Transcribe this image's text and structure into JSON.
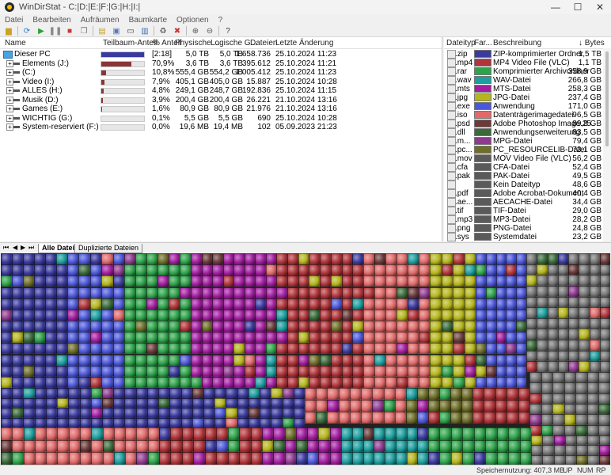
{
  "window": {
    "title": "WinDirStat - C:|D:|E:|F:|G:|H:|I:|"
  },
  "menu": [
    "Datei",
    "Bearbeiten",
    "Aufräumen",
    "Baumkarte",
    "Optionen",
    "?"
  ],
  "toolbar_icons": [
    "folder-open-icon",
    "refresh-icon",
    "play-icon",
    "pause-icon",
    "stop-icon",
    "copy-icon",
    "clipboard-icon",
    "explorer-icon",
    "cmd-icon",
    "properties-icon",
    "properties-icon",
    "recycle-icon",
    "delete-icon",
    "zoom-in-icon",
    "zoom-out-icon",
    "help-icon"
  ],
  "tree": {
    "headers": {
      "name": "Name",
      "subtree": "Teilbaum-Anteil",
      "percent": "% Anteil",
      "physical": "Physische ...",
      "logical": "Logische G...",
      "files": "Dateien",
      "modified": "Letzte Änderung"
    },
    "rows": [
      {
        "name": "Dieser PC",
        "bar_label": "[2:18]",
        "percent": "",
        "physical": "5,0 TB",
        "logical": "5,0 TB",
        "files": "1.658.736",
        "modified": "25.10.2024 11:23",
        "fill": 1.0
      },
      {
        "name": "Elements (J:)",
        "bar_label": "",
        "percent": "70,9%",
        "physical": "3,6 TB",
        "logical": "3,6 TB",
        "files": "395.612",
        "modified": "25.10.2024 11:21",
        "fill": 0.709
      },
      {
        "name": "(C:)",
        "bar_label": "",
        "percent": "10,8%",
        "physical": "555,4 GB",
        "logical": "554,2 GB",
        "files": "1.005.412",
        "modified": "25.10.2024 11:23",
        "fill": 0.108
      },
      {
        "name": "Video (I:)",
        "bar_label": "",
        "percent": "7,9%",
        "physical": "405,1 GB",
        "logical": "405,0 GB",
        "files": "15.887",
        "modified": "25.10.2024 10:28",
        "fill": 0.079
      },
      {
        "name": "ALLES (H:)",
        "bar_label": "",
        "percent": "4,8%",
        "physical": "249,1 GB",
        "logical": "248,7 GB",
        "files": "192.836",
        "modified": "25.10.2024 11:15",
        "fill": 0.048
      },
      {
        "name": "Musik (D:)",
        "bar_label": "",
        "percent": "3,9%",
        "physical": "200,4 GB",
        "logical": "200,4 GB",
        "files": "26.221",
        "modified": "21.10.2024 13:16",
        "fill": 0.039
      },
      {
        "name": "Games (E:)",
        "bar_label": "",
        "percent": "1,6%",
        "physical": "80,9 GB",
        "logical": "80,9 GB",
        "files": "21.976",
        "modified": "21.10.2024 13:16",
        "fill": 0.016
      },
      {
        "name": "WICHTIG (G:)",
        "bar_label": "",
        "percent": "0,1%",
        "physical": "5,5 GB",
        "logical": "5,5 GB",
        "files": "690",
        "modified": "25.10.2024 10:28",
        "fill": 0.001
      },
      {
        "name": "System-reserviert (F:)",
        "bar_label": "",
        "percent": "0,0%",
        "physical": "19,6 MB",
        "logical": "19,4 MB",
        "files": "102",
        "modified": "05.09.2023 21:23",
        "fill": 0.0
      }
    ]
  },
  "extensions": {
    "headers": {
      "type": "Dateityp",
      "color": "Far...",
      "description": "Beschreibung",
      "bytes": "↓ Bytes"
    },
    "rows": [
      {
        "ext": ".zip",
        "color": "#3b3b9e",
        "desc": "ZIP-komprimierter Ordner",
        "bytes": "1,5 TB"
      },
      {
        "ext": ".mp4",
        "color": "#b0353a",
        "desc": "MP4 Video File (VLC)",
        "bytes": "1,1 TB"
      },
      {
        "ext": ".rar",
        "color": "#2fa34b",
        "desc": "Komprimierter Archivordner",
        "bytes": "358,9 GB"
      },
      {
        "ext": ".wav",
        "color": "#1e9e9e",
        "desc": "WAV-Datei",
        "bytes": "266,8 GB"
      },
      {
        "ext": ".mts",
        "color": "#a21ea0",
        "desc": "MTS-Datei",
        "bytes": "258,3 GB"
      },
      {
        "ext": ".jpg",
        "color": "#b5b51e",
        "desc": "JPG-Datei",
        "bytes": "237,4 GB"
      },
      {
        "ext": ".exe",
        "color": "#4d58d8",
        "desc": "Anwendung",
        "bytes": "171,0 GB"
      },
      {
        "ext": ".iso",
        "color": "#e06a6a",
        "desc": "Datenträgerimagedatei",
        "bytes": "96,5 GB"
      },
      {
        "ext": ".psd",
        "color": "#6a3a3a",
        "desc": "Adobe Photoshop Image.25",
        "bytes": "89,8 GB"
      },
      {
        "ext": ".dll",
        "color": "#3a6a3a",
        "desc": "Anwendungserweiterung",
        "bytes": "83,5 GB"
      },
      {
        "ext": ".m...",
        "color": "#8e3a8e",
        "desc": "MPG-Datei",
        "bytes": "79,4 GB"
      },
      {
        "ext": ".pc...",
        "color": "#6e6e2a",
        "desc": "PC_RESOURCELIB-Datei",
        "bytes": "73,1 GB"
      },
      {
        "ext": ".mov",
        "color": "#5a5a5a",
        "desc": "MOV Video File (VLC)",
        "bytes": "56,2 GB"
      },
      {
        "ext": ".cfa",
        "color": "#5a5a5a",
        "desc": "CFA-Datei",
        "bytes": "52,4 GB"
      },
      {
        "ext": ".pak",
        "color": "#5a5a5a",
        "desc": "PAK-Datei",
        "bytes": "49,5 GB"
      },
      {
        "ext": "",
        "color": "#5a5a5a",
        "desc": "Kein Dateityp",
        "bytes": "48,6 GB"
      },
      {
        "ext": ".pdf",
        "color": "#5a5a5a",
        "desc": "Adobe Acrobat-Dokument",
        "bytes": "40,4 GB"
      },
      {
        "ext": ".ae...",
        "color": "#5a5a5a",
        "desc": "AECACHE-Datei",
        "bytes": "34,4 GB"
      },
      {
        "ext": ".tif",
        "color": "#5a5a5a",
        "desc": "TIF-Datei",
        "bytes": "29,0 GB"
      },
      {
        "ext": ".mp3",
        "color": "#5a5a5a",
        "desc": "MP3-Datei",
        "bytes": "28,2 GB"
      },
      {
        "ext": ".png",
        "color": "#5a5a5a",
        "desc": "PNG-Datei",
        "bytes": "24,8 GB"
      },
      {
        "ext": ".sys",
        "color": "#5a5a5a",
        "desc": "Systemdatei",
        "bytes": "23,2 GB"
      }
    ]
  },
  "tabs": {
    "all_files": "Alle Dateien",
    "duplicates": "Duplizierte Dateien"
  },
  "status": {
    "memory": "Speichernutzung: 407,3 MB",
    "up": "UP",
    "num": "NUM",
    "rp": "RP"
  }
}
